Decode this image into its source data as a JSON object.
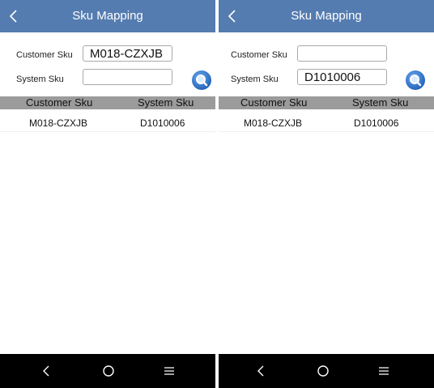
{
  "screens": [
    {
      "title": "Sku Mapping",
      "form": {
        "customer_sku_label": "Customer Sku",
        "customer_sku_value": "M018-CZXJB",
        "system_sku_label": "System Sku",
        "system_sku_value": ""
      },
      "table": {
        "headers": [
          "Customer Sku",
          "System Sku"
        ],
        "rows": [
          [
            "M018-CZXJB",
            "D1010006"
          ]
        ]
      }
    },
    {
      "title": "Sku Mapping",
      "form": {
        "customer_sku_label": "Customer Sku",
        "customer_sku_value": "",
        "system_sku_label": "System Sku",
        "system_sku_value": "D1010006"
      },
      "table": {
        "headers": [
          "Customer Sku",
          "System Sku"
        ],
        "rows": [
          [
            "M018-CZXJB",
            "D1010006"
          ]
        ]
      }
    }
  ],
  "icons": {
    "back": "chevron-left-icon",
    "search": "search-icon",
    "nav_back": "back-nav-icon",
    "nav_home": "home-circle-icon",
    "nav_menu": "menu-lines-icon"
  },
  "colors": {
    "titlebar": "#557cb0",
    "table_header": "#9b9b9b",
    "search_button": "#2f6fc2",
    "navbar": "#000000"
  }
}
